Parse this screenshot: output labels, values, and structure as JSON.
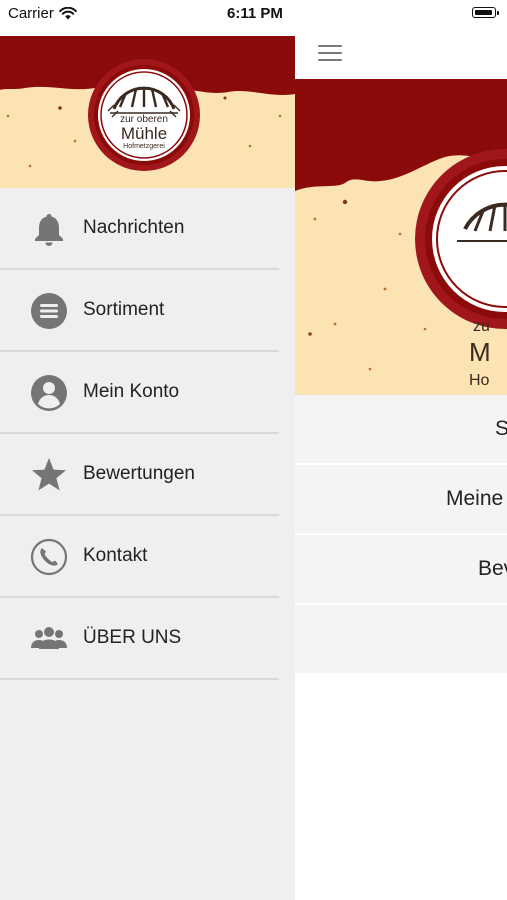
{
  "status_bar": {
    "carrier": "Carrier",
    "time": "6:11 PM"
  },
  "logo": {
    "line1": "zur oberen",
    "line2": "Mühle",
    "line3": "Hofmetzgerei"
  },
  "drawer": {
    "items": [
      {
        "label": "Nachrichten",
        "icon": "bell-icon"
      },
      {
        "label": "Sortiment",
        "icon": "list-icon"
      },
      {
        "label": "Mein Konto",
        "icon": "account-icon"
      },
      {
        "label": "Bewertungen",
        "icon": "star-icon"
      },
      {
        "label": "Kontakt",
        "icon": "phone-icon"
      },
      {
        "label": "ÜBER UNS",
        "icon": "group-icon"
      }
    ]
  },
  "main": {
    "list_fragments": [
      "S",
      "Meine",
      "Bev",
      ""
    ]
  },
  "colors": {
    "brand_red": "#8b0a0a",
    "paper": "#fbe3b4",
    "icon_gray": "#757575"
  }
}
